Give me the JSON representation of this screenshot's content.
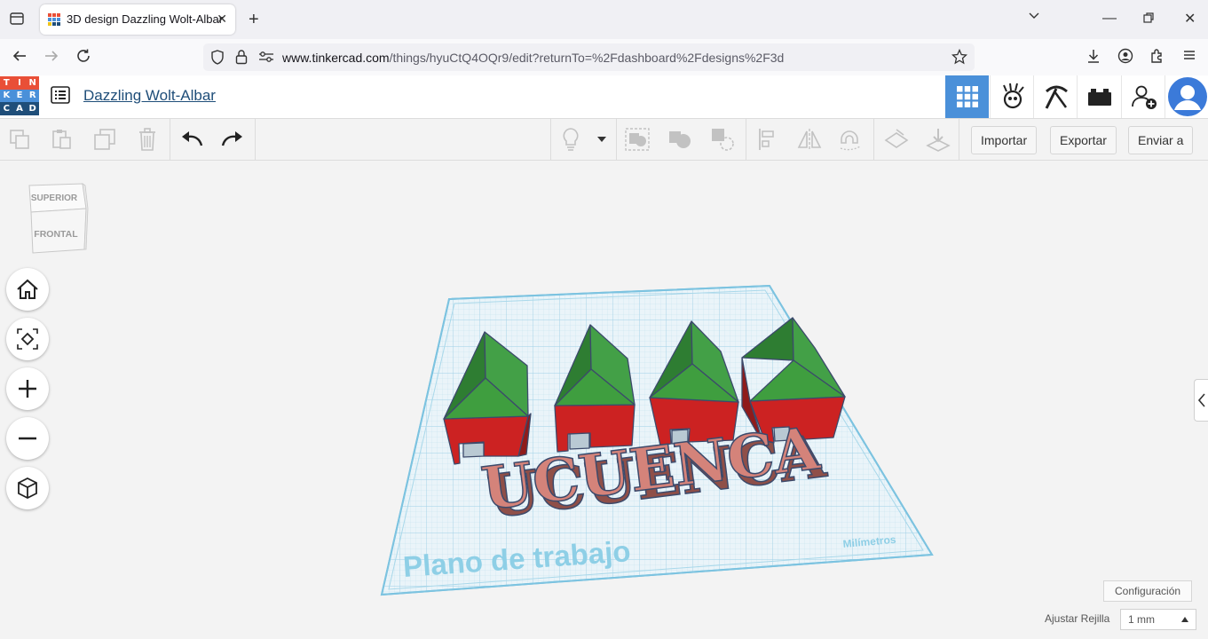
{
  "browser": {
    "tab_title": "3D design Dazzling Wolt-Albar",
    "url_domain": "www.tinkercad.com",
    "url_path": "/things/hyuCtQ4OQr9/edit?returnTo=%2Fdashboard%2Fdesigns%2F3d"
  },
  "logo_letters": [
    "T",
    "I",
    "N",
    "K",
    "E",
    "R",
    "C",
    "A",
    "D"
  ],
  "logo_colors": [
    "#e94f37",
    "#e94f37",
    "#e94f37",
    "#4a90d9",
    "#4a90d9",
    "#4a90d9",
    "#1f4e79",
    "#1f4e79",
    "#1f4e79"
  ],
  "app": {
    "design_title": "Dazzling Wolt-Albar",
    "header_icons": [
      "grid-view-icon",
      "tinkerer-icon",
      "pickaxe-icon",
      "bricks-icon",
      "add-user-icon",
      "avatar"
    ],
    "accent": "#4a90d9"
  },
  "toolbar": {
    "import_label": "Importar",
    "export_label": "Exportar",
    "send_label": "Enviar a"
  },
  "viewcube": {
    "top": "SUPERIOR",
    "front": "FRONTAL"
  },
  "scene": {
    "text_object": "UCUENCA",
    "workplane_label": "Plano de trabajo",
    "units_label": "Milímetros",
    "house_count": 4,
    "roof_color": "#3f9e3f",
    "wall_color": "#cc2222",
    "text_color": "#d4837a"
  },
  "bottom": {
    "settings_label": "Configuración",
    "grid_label": "Ajustar Rejilla",
    "grid_value": "1 mm"
  }
}
